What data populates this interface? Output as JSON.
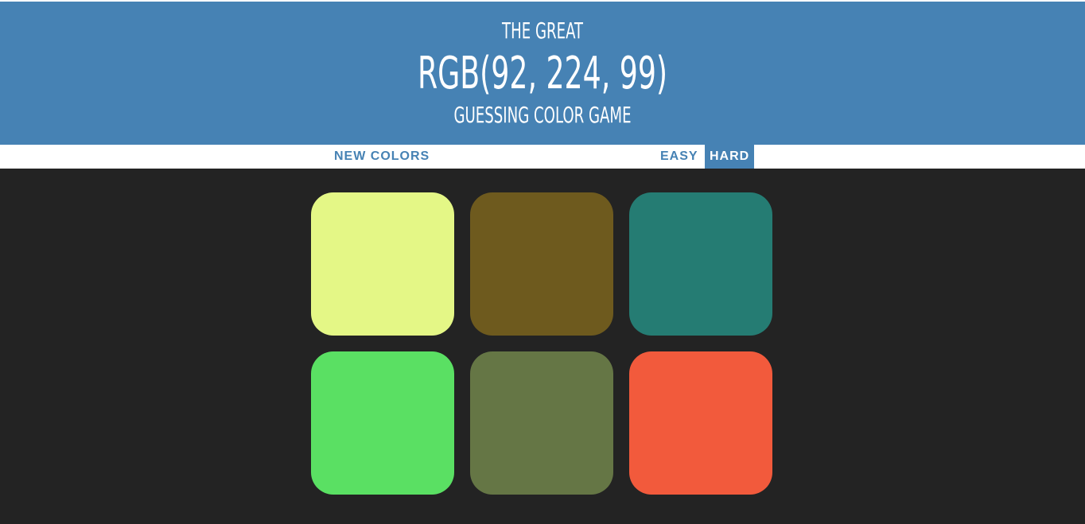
{
  "header": {
    "line1": "THE GREAT",
    "rgb_display": "RGB(92, 224, 99)",
    "line3": "GUESSING COLOR GAME"
  },
  "controls": {
    "new_colors_label": "NEW COLORS",
    "message": "",
    "easy_label": "EASY",
    "hard_label": "HARD",
    "selected_mode": "HARD"
  },
  "colors": {
    "header_bg": "#4682b4",
    "body_bg": "#232323",
    "squares": [
      "#e4f786",
      "#6e5a1e",
      "#257c73",
      "#5ae063",
      "#657645",
      "#f25a3c"
    ]
  }
}
